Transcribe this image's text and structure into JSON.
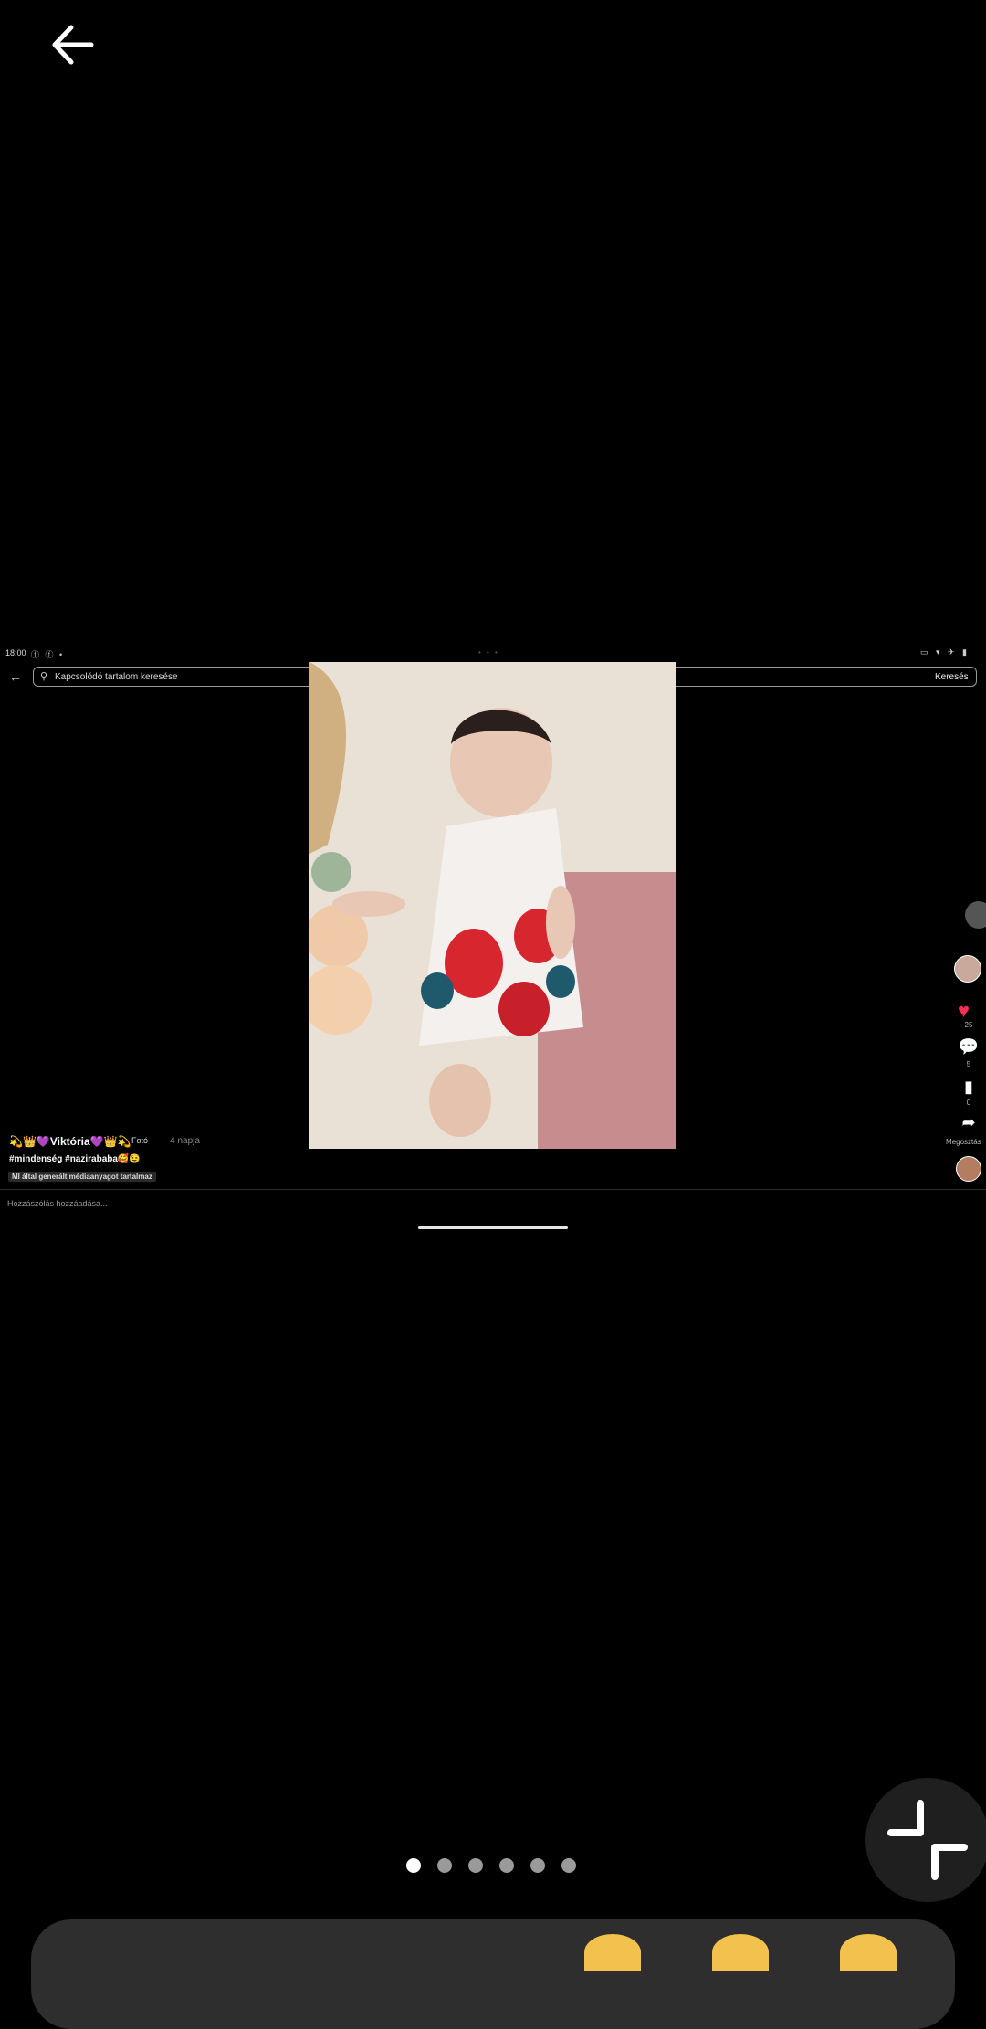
{
  "viewer": {
    "page_count": 6,
    "current_page": 1
  },
  "screenshot": {
    "status_time": "18:00",
    "search_placeholder": "Kapcsolódó tartalom keresése",
    "search_button": "Keresés",
    "post": {
      "username": "💫👑💜Viktória💜👑💫",
      "type_label": "Fotó",
      "time_ago": "· 4 napja",
      "hashtags": "#mindenség #nazirababa🥰😉",
      "ai_label": "MI által generált médiaanyagot tartalmaz"
    },
    "rail": {
      "likes": "25",
      "comments": "5",
      "saves": "0",
      "share_label": "Megosztás"
    },
    "comment_placeholder": "Hozzászólás hozzáadása..."
  },
  "icons": {
    "back": "arrow-left-icon",
    "exit_fullscreen": "collapse-icon",
    "like": "heart-icon",
    "comment": "comment-icon",
    "save": "bookmark-icon",
    "share": "share-icon"
  },
  "colors": {
    "like": "#ff2d55",
    "background": "#000000"
  }
}
